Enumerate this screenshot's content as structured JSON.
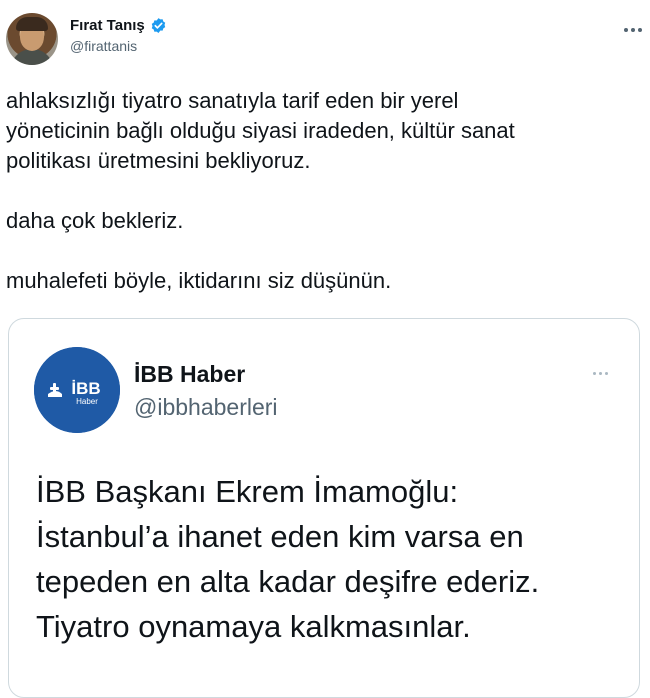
{
  "author": {
    "name": "Fırat Tanış",
    "handle": "@firattanis",
    "verified": true,
    "verified_color": "#1d9bf0"
  },
  "tweet": {
    "text": "ahlaksızlığı tiyatro sanatıyla tarif eden bir yerel\nyöneticinin bağlı olduğu siyasi iradeden, kültür sanat\npolitikası üretmesini bekliyoruz.\n\ndaha çok bekleriz.\n\nmuhalefeti böyle, iktidarını siz düşünün."
  },
  "quoted": {
    "name": "İBB Haber",
    "handle": "@ibbhaberleri",
    "avatar_logo": "İBB",
    "avatar_sub": "Haber",
    "avatar_color": "#1f5aa6",
    "text": "İBB Başkanı Ekrem İmamoğlu:\nİstanbul’a ihanet eden kim varsa en\ntepeden en alta kadar deşifre ederiz.\nTiyatro oynamaya kalkmasınlar."
  },
  "icons": {
    "more": "more-options-icon",
    "verified": "verified-badge-icon"
  }
}
